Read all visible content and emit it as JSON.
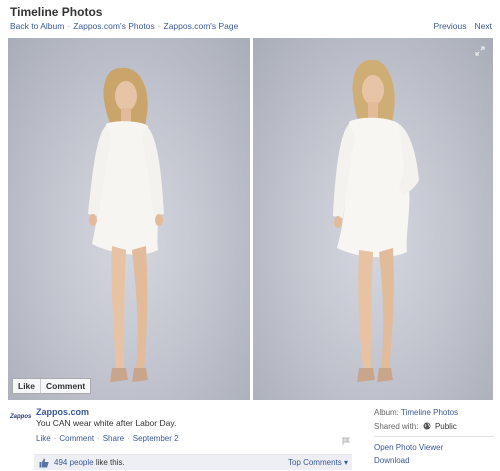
{
  "header": {
    "title": "Timeline Photos",
    "breadcrumbs": [
      "Back to Album",
      "Zappos.com's Photos",
      "Zappos.com's Page"
    ],
    "breadcrumb_separator": "·",
    "previous_label": "Previous",
    "next_label": "Next"
  },
  "photo": {
    "like_label": "Like",
    "comment_label": "Comment",
    "expand_icon": "expand-icon"
  },
  "post": {
    "logo_text": "Zappos",
    "author": "Zappos.com",
    "text": "You CAN wear white after Labor Day.",
    "actions": [
      "Like",
      "Comment",
      "Share"
    ],
    "date": "September 2",
    "dot": "·"
  },
  "likes": {
    "count_link": "494 people",
    "suffix": "like this.",
    "top_comments": "Top Comments ▾"
  },
  "sidebar": {
    "album_label": "Album:",
    "album_value": "Timeline Photos",
    "shared_label": "Shared with:",
    "shared_value": "Public",
    "links": [
      "Open Photo Viewer",
      "Download"
    ]
  },
  "colors": {
    "link": "#3b5998",
    "likes_bar_bg": "#edeff4",
    "photo_bg": "#bfc2cc"
  }
}
